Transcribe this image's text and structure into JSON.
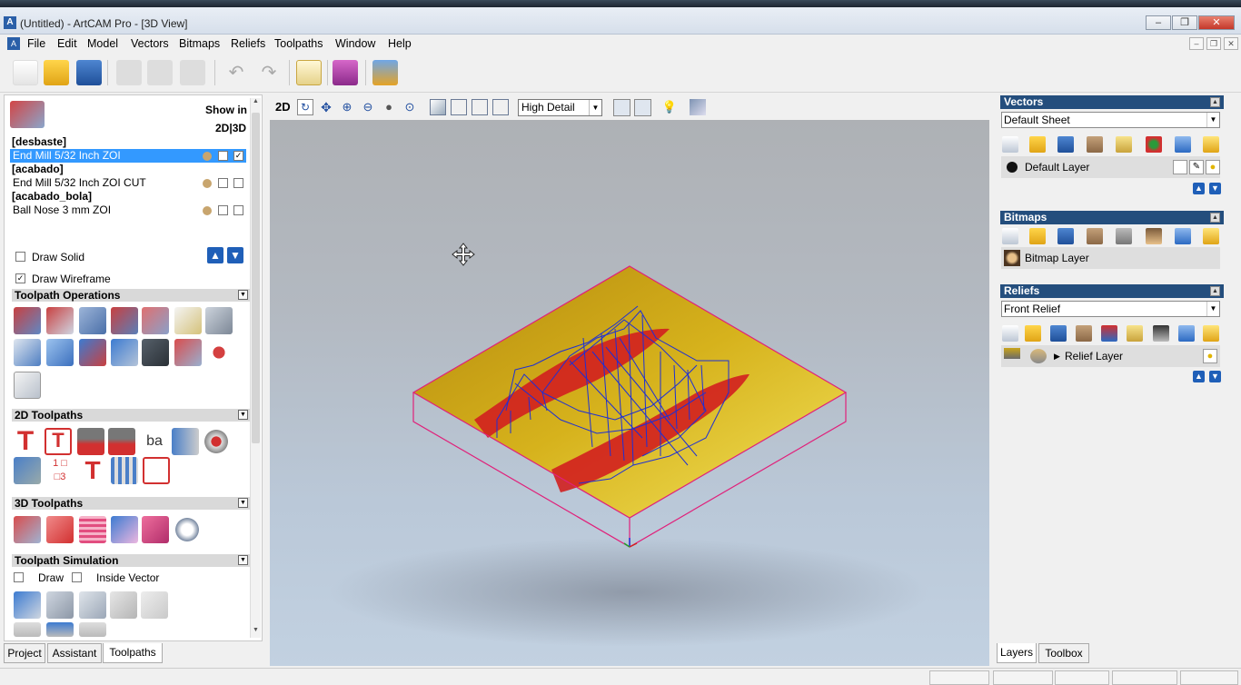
{
  "window": {
    "title": "(Untitled) - ArtCAM Pro - [3D View]"
  },
  "menu": [
    "File",
    "Edit",
    "Model",
    "Vectors",
    "Bitmaps",
    "Reliefs",
    "Toolpaths",
    "Window",
    "Help"
  ],
  "toolpaths_panel": {
    "show_in": "Show in",
    "show_in_modes": "2D|3D",
    "groups": [
      {
        "name": "[desbaste]",
        "tool": "End Mill 5/32 Inch ZOI"
      },
      {
        "name": "[acabado]",
        "tool": "End Mill 5/32 Inch ZOI CUT"
      },
      {
        "name": "[acabado_bola]",
        "tool": "Ball Nose 3 mm ZOI"
      }
    ],
    "draw_solid": "Draw Solid",
    "draw_wireframe": "Draw Wireframe",
    "sections": {
      "operations": "Toolpath Operations",
      "toolpaths_2d": "2D Toolpaths",
      "toolpaths_3d": "3D Toolpaths",
      "simulation": "Toolpath Simulation"
    },
    "sim_draw": "Draw",
    "sim_inside_vector": "Inside Vector"
  },
  "left_tabs": [
    "Project",
    "Assistant",
    "Toolpaths"
  ],
  "view_toolbar": {
    "label_2d": "2D",
    "detail_level": "High Detail"
  },
  "right_panel": {
    "vectors": {
      "title": "Vectors",
      "sheet": "Default Sheet",
      "layer": "Default Layer"
    },
    "bitmaps": {
      "title": "Bitmaps",
      "layer": "Bitmap Layer"
    },
    "reliefs": {
      "title": "Reliefs",
      "relief": "Front Relief",
      "layer": "Relief Layer"
    },
    "tabs": [
      "Layers",
      "Toolbox"
    ]
  },
  "colors": {
    "panel_header": "#244e7d",
    "selection": "#3399ff",
    "model_gold": "#c9a41a",
    "toolpath_red": "#d61c1c",
    "toolpath_blue": "#1c2fd6",
    "bounding_box": "#e0207a"
  }
}
